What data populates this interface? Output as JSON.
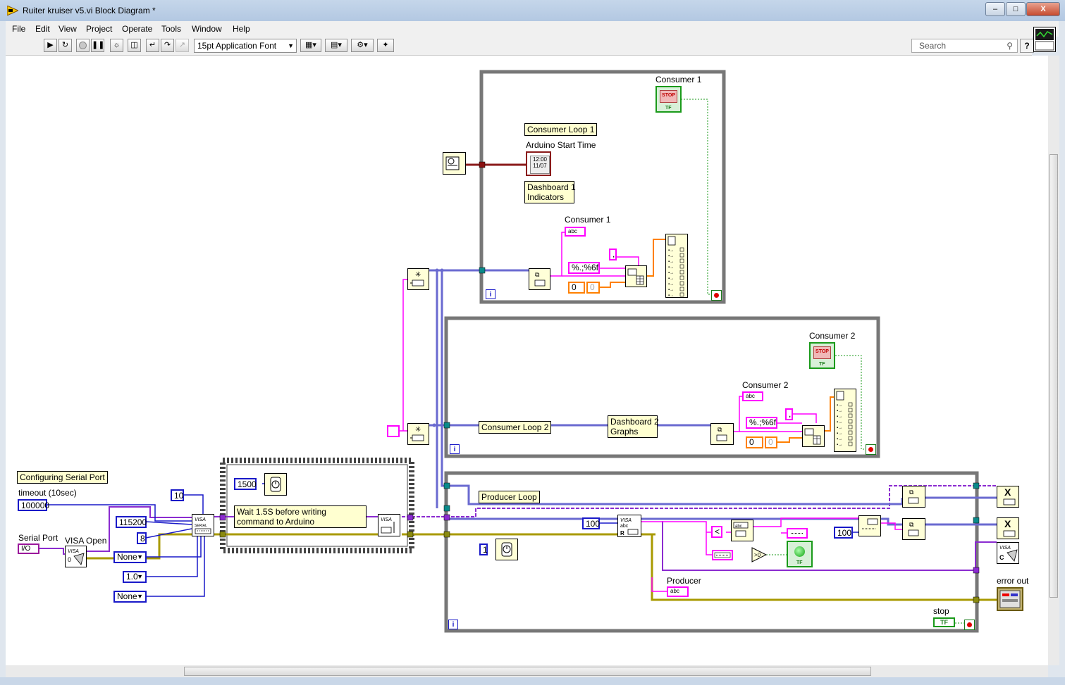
{
  "window": {
    "title": "Ruiter kruiser v5.vi Block Diagram *",
    "min_label": "‒",
    "max_label": "□",
    "close_label": "X"
  },
  "menu": [
    "File",
    "Edit",
    "View",
    "Project",
    "Operate",
    "Tools",
    "Window",
    "Help"
  ],
  "toolbar": {
    "font_ring": "15pt Application Font",
    "search_placeholder": "Search",
    "help_label": "?"
  },
  "colors": {
    "error_wire": "#b8a800",
    "visa_wire": "#8b2bd0",
    "queue_wire": "#0a8a8a",
    "string_wire": "#ff00ff",
    "numeric_wire": "#1919c8",
    "orange_wire": "#ff8000",
    "bool_wire": "#1a9a1a",
    "timestamp_wire": "#8a0a0a",
    "structure_border": "#777777"
  },
  "diagram": {
    "config_comment": "Configuring Serial Port",
    "timeout_label": "timeout (10sec)",
    "timeout_value": "100000",
    "serial_port_label": "Serial Port",
    "serial_port_const": "I/O",
    "visa_open_label": "VISA Open",
    "baud_rate": "115200",
    "data_bits": "8",
    "flow_control": "10",
    "parity_ring": "None",
    "stop_bits_ring": "1.0",
    "flow_ring": "None",
    "wait_ms": "1500",
    "wait_comment": "Wait 1.5S before writing command to Arduino",
    "consumer1_loop": {
      "stop_label": "Consumer 1",
      "stop_face": "STOP",
      "comment": "Consumer Loop 1",
      "start_time_label": "Arduino Start Time",
      "time_text": "12:00\n11/07",
      "indicators_comment": "Dashboard 1\nIndicators",
      "string_label": "Consumer 1",
      "string_const": "abc",
      "format": "%.;%6f",
      "zero_const": "0",
      "zero_ind": "0",
      "delim_const": ","
    },
    "consumer2_loop": {
      "stop_label": "Consumer 2",
      "stop_face": "STOP",
      "comment": "Consumer Loop 2",
      "graphs_comment": "Dashboard 2\nGraphs",
      "string_label": "Consumer 2",
      "string_const": "abc",
      "format": "%.;%6f",
      "zero_const": "0",
      "zero_ind": "0",
      "delim_const": ","
    },
    "producer_loop": {
      "comment": "Producer Loop",
      "bytes_to_read": "100",
      "wait_ms": "1",
      "compare_char": "<",
      "max_len": "100",
      "producer_label": "Producer",
      "producer_const": "abc",
      "stop_label": "stop",
      "stop_tf": "TF",
      "led_tf": "TF"
    },
    "error_out_label": "error out",
    "iteration_label": "i",
    "tf_label": "TF",
    "release_label": "X"
  }
}
